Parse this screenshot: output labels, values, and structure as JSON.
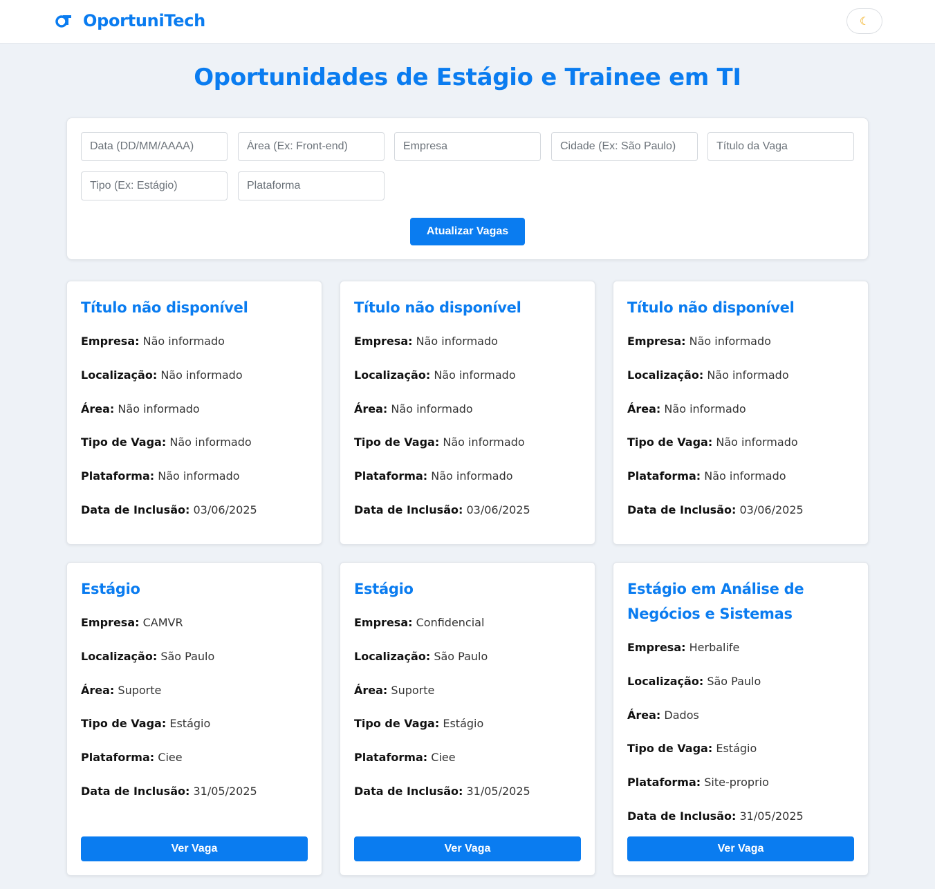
{
  "header": {
    "brand": "OportuniTech",
    "theme_icon": "moon-icon",
    "theme_glyph": "☾"
  },
  "page": {
    "title": "Oportunidades de Estágio e Trainee em TI"
  },
  "filters": {
    "date_placeholder": "Data (DD/MM/AAAA)",
    "area_placeholder": "Área (Ex: Front-end)",
    "company_placeholder": "Empresa",
    "city_placeholder": "Cidade (Ex: São Paulo)",
    "title_placeholder": "Título da Vaga",
    "type_placeholder": "Tipo (Ex: Estágio)",
    "platform_placeholder": "Plataforma",
    "update_label": "Atualizar Vagas"
  },
  "labels": {
    "company": "Empresa:",
    "location": "Localização:",
    "area": "Área:",
    "type": "Tipo de Vaga:",
    "platform": "Plataforma:",
    "date": "Data de Inclusão:",
    "view": "Ver Vaga"
  },
  "jobs": [
    {
      "title": "Título não disponível",
      "company": "Não informado",
      "location": "Não informado",
      "area": "Não informado",
      "type": "Não informado",
      "platform": "Não informado",
      "date": "03/06/2025"
    },
    {
      "title": "Título não disponível",
      "company": "Não informado",
      "location": "Não informado",
      "area": "Não informado",
      "type": "Não informado",
      "platform": "Não informado",
      "date": "03/06/2025"
    },
    {
      "title": "Título não disponível",
      "company": "Não informado",
      "location": "Não informado",
      "area": "Não informado",
      "type": "Não informado",
      "platform": "Não informado",
      "date": "03/06/2025"
    },
    {
      "title": "Estágio",
      "company": "CAMVR",
      "location": "São Paulo",
      "area": "Suporte",
      "type": "Estágio",
      "platform": "Ciee",
      "date": "31/05/2025"
    },
    {
      "title": "Estágio",
      "company": "Confidencial",
      "location": "São Paulo",
      "area": "Suporte",
      "type": "Estágio",
      "platform": "Ciee",
      "date": "31/05/2025"
    },
    {
      "title": "Estágio em Análise de Negócios e Sistemas",
      "company": "Herbalife",
      "location": "São Paulo",
      "area": "Dados",
      "type": "Estágio",
      "platform": "Site-proprio",
      "date": "31/05/2025"
    }
  ],
  "colors": {
    "accent": "#0a7cf0",
    "background": "#eef2f7",
    "moon": "#f0a500"
  }
}
